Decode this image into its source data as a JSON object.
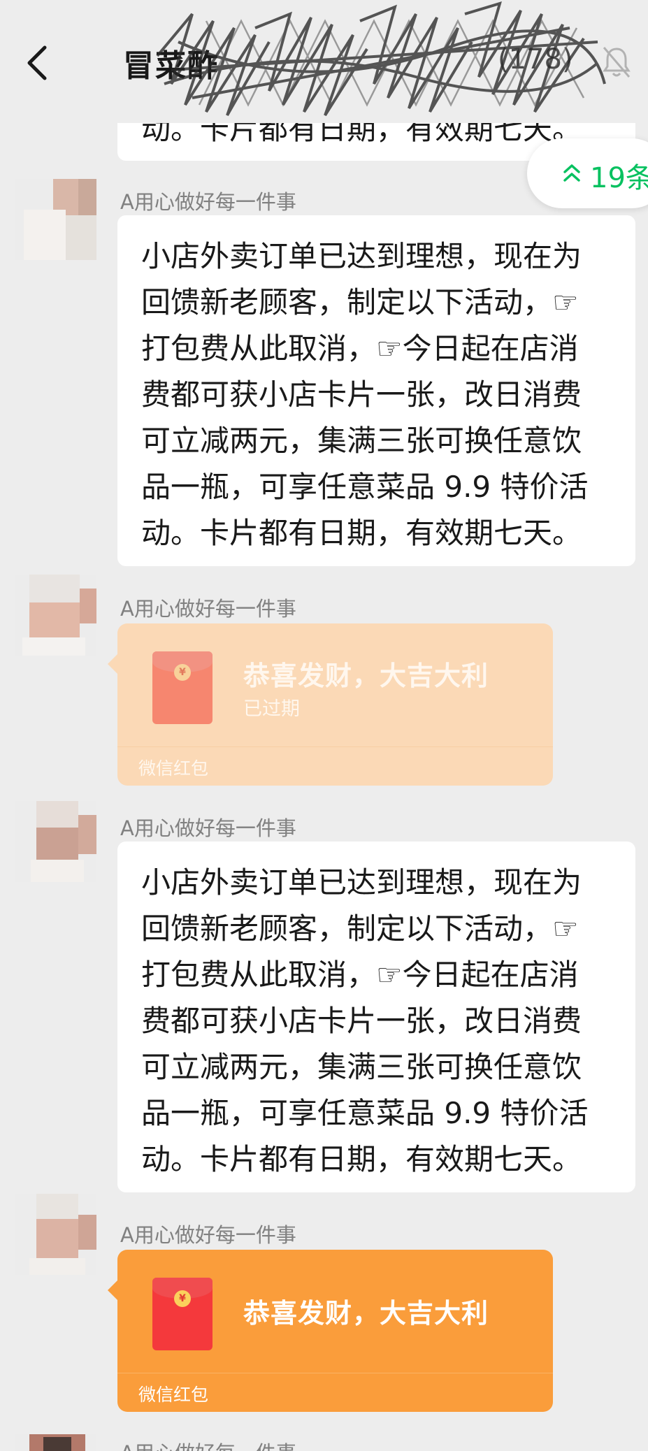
{
  "header": {
    "title": "冒菜酢",
    "member_count": "(178)",
    "back_icon": "back-chevron-icon",
    "mute_icon": "bell-muted-icon"
  },
  "unread": {
    "label": "19条",
    "icon": "double-chevron-up-icon",
    "color": "#07c160"
  },
  "messages": [
    {
      "type": "text",
      "text_tail": "动。卡片都有日期，有效期七天。"
    },
    {
      "type": "text",
      "sender": "A用心做好每一件事",
      "text": "小店外卖订单已达到理想，现在为\n回馈新老顾客，制定以下活动，☞\n打包费从此取消，☞今日起在店消\n费都可获小店卡片一张，改日消费\n可立减两元，集满三张可换任意饮\n品一瓶，可享任意菜品 9.9 特价活\n动。卡片都有日期，有效期七天。"
    },
    {
      "type": "red_packet",
      "sender": "A用心做好每一件事",
      "title": "恭喜发财，大吉大利",
      "status": "已过期",
      "footer": "微信红包",
      "color": "#fbd9b6"
    },
    {
      "type": "text",
      "sender": "A用心做好每一件事",
      "text": "小店外卖订单已达到理想，现在为\n回馈新老顾客，制定以下活动，☞\n打包费从此取消，☞今日起在店消\n费都可获小店卡片一张，改日消费\n可立减两元，集满三张可换任意饮\n品一瓶，可享任意菜品 9.9 特价活\n动。卡片都有日期，有效期七天。"
    },
    {
      "type": "red_packet",
      "sender": "A用心做好每一件事",
      "title": "恭喜发财，大吉大利",
      "footer": "微信红包",
      "color": "#fa9d3b"
    },
    {
      "type": "text",
      "sender": "A用心做好每一件事"
    }
  ]
}
